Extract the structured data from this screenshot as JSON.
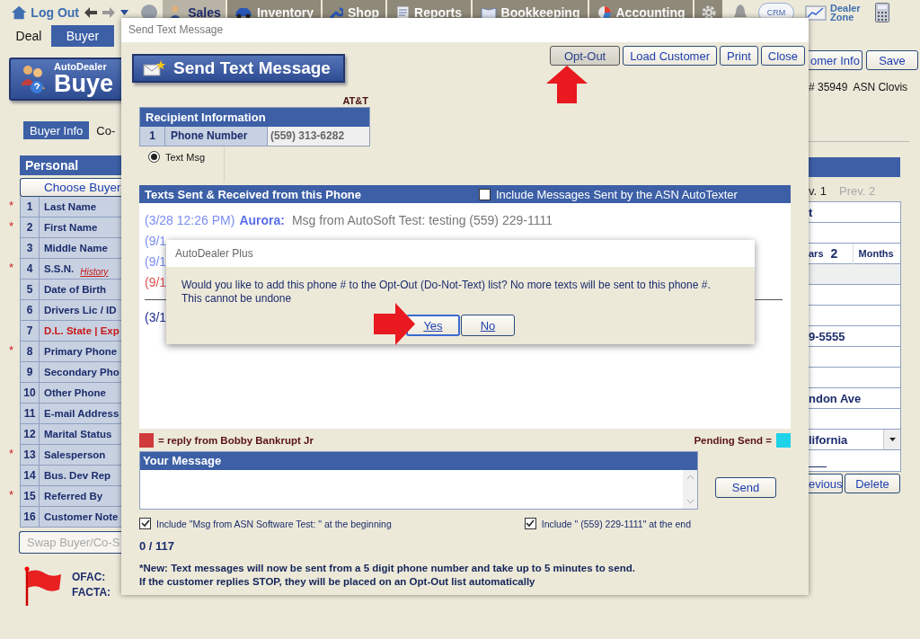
{
  "nav": {
    "logout": "Log Out",
    "tabs": [
      {
        "label": "Sales",
        "selected": true
      },
      {
        "label": "Inventory",
        "selected": false
      },
      {
        "label": "Shop",
        "selected": false
      },
      {
        "label": "Reports",
        "selected": false
      },
      {
        "label": "Bookkeeping",
        "selected": false
      },
      {
        "label": "Accounting",
        "selected": false
      }
    ],
    "crm": "CRM",
    "dealer_zone": [
      "Dealer",
      "Zone"
    ]
  },
  "subtabs": [
    {
      "label": "Deal",
      "selected": false
    },
    {
      "label": "Buyer",
      "selected": true
    }
  ],
  "banner": {
    "product": "AutoDealer",
    "title": "Buye"
  },
  "buyer_tabs": [
    {
      "label": "Buyer Info",
      "selected": true
    },
    {
      "label": "Co-",
      "selected": false
    }
  ],
  "personal": {
    "title": "Personal",
    "choose_button": "Choose Buyer",
    "rows": [
      {
        "mark": "*",
        "number": "1",
        "label": "Last Name",
        "warning": false
      },
      {
        "mark": "*",
        "number": "2",
        "label": "First Name",
        "warning": false
      },
      {
        "number": "3",
        "label": "Middle Name",
        "warning": false
      },
      {
        "mark": "*",
        "number": "4",
        "label": "S.S.N.",
        "warning": false,
        "link": "History"
      },
      {
        "number": "5",
        "label": "Date of Birth",
        "warning": false
      },
      {
        "number": "6",
        "label": "Drivers Lic / ID",
        "warning": false
      },
      {
        "number": "7",
        "label": "D.L. State | Exp",
        "warning": true
      },
      {
        "mark": "*",
        "number": "8",
        "label": "Primary Phone",
        "warning": false
      },
      {
        "number": "9",
        "label": "Secondary Pho",
        "warning": false
      },
      {
        "number": "10",
        "label": "Other Phone",
        "warning": false
      },
      {
        "number": "11",
        "label": "E-mail Address",
        "warning": false
      },
      {
        "number": "12",
        "label": "Marital Status",
        "warning": false
      },
      {
        "mark": "*",
        "number": "13",
        "label": "Salesperson",
        "warning": false
      },
      {
        "number": "14",
        "label": "Bus. Dev Rep",
        "warning": false
      },
      {
        "mark": "*",
        "number": "15",
        "label": "Referred By",
        "warning": false
      },
      {
        "number": "16",
        "label": "Customer Note",
        "warning": false
      }
    ],
    "swap_button": "Swap Buyer/Co-S",
    "swap_disabled": true
  },
  "flags": [
    "OFAC:",
    "FACTA:"
  ],
  "right_panel": {
    "buttons": [
      "omer Info",
      "Save"
    ],
    "dealer": "# 35949  ASN Clovis",
    "history_tabs": [
      {
        "label": "v. 1",
        "selected": true
      },
      {
        "label": "Prev. 2",
        "selected": false
      }
    ],
    "rows": [
      {
        "kind": "text",
        "value": "t"
      },
      {
        "kind": "blank"
      },
      {
        "kind": "duration",
        "values": [
          "ars",
          "2",
          "Months"
        ]
      },
      {
        "kind": "shaded"
      },
      {
        "kind": "blank"
      },
      {
        "kind": "blank"
      },
      {
        "kind": "text",
        "value": "9-5555"
      },
      {
        "kind": "blank"
      },
      {
        "kind": "blank"
      },
      {
        "kind": "text",
        "value": "ndon Ave"
      },
      {
        "kind": "blank"
      },
      {
        "kind": "select",
        "value": "lifornia"
      },
      {
        "kind": "underline"
      }
    ],
    "nav_buttons": [
      "evious",
      "Delete"
    ]
  },
  "dialog": {
    "title": "Send Text Message",
    "heading": "Send Text Message",
    "buttons": [
      {
        "label": "Opt-Out",
        "selected": true
      },
      {
        "label": "Load Customer",
        "selected": false
      },
      {
        "label": "Print",
        "selected": false
      },
      {
        "label": "Close",
        "selected": false
      }
    ],
    "carrier": "AT&T",
    "recipient": {
      "title": "Recipient Information",
      "rows": [
        {
          "number": "1",
          "label": "Phone Number",
          "value": "(559) 313-6282"
        }
      ],
      "options": [
        {
          "label": "Text Msg",
          "selected": true
        }
      ]
    },
    "history": {
      "title": "Texts Sent & Received from this Phone",
      "include": {
        "label": "Include Messages Sent by the ASN AutoTexter",
        "checked": false
      },
      "messages": [
        {
          "kind": "sent",
          "time": "(3/28 12:26 PM)",
          "sender": "Aurora:",
          "text": "Msg from AutoSoft Test: testing (559) 229-1111"
        },
        {
          "kind": "sent",
          "time": "(9/1"
        },
        {
          "kind": "sent",
          "time": "(9/1"
        },
        {
          "kind": "reply",
          "time": "(9/1"
        },
        {
          "kind": "divider"
        },
        {
          "kind": "other",
          "time": "(3/1"
        }
      ]
    },
    "legend": [
      {
        "kind": "swatch_before",
        "label": "= reply from Bobby Bankrupt Jr",
        "color": "#d03a3a"
      },
      {
        "kind": "swatch_after",
        "label": "Pending Send =",
        "color": "#1ed3e8"
      }
    ],
    "compose": {
      "title": "Your Message",
      "send": "Send",
      "options": [
        {
          "label": "Include \"Msg from ASN Software Test: \" at the beginning",
          "checked": true
        },
        {
          "label": "Include \" (559) 229-1111\" at the end",
          "checked": true
        }
      ],
      "counter": "0 / 117",
      "notes": [
        "*New: Text messages will now be sent from a 5 digit phone number and take up to 5 minutes to send.",
        "If the customer replies STOP, they will be placed on an Opt-Out list automatically"
      ]
    }
  },
  "alert": {
    "title": "AutoDealer Plus",
    "message": [
      "Would you like to add this phone # to the Opt-Out (Do-Not-Text) list?  No more texts will be sent to this phone #.",
      "This cannot be undone"
    ],
    "buttons": [
      {
        "label": "Yes",
        "focused": true
      },
      {
        "label": "No",
        "focused": false
      }
    ]
  }
}
